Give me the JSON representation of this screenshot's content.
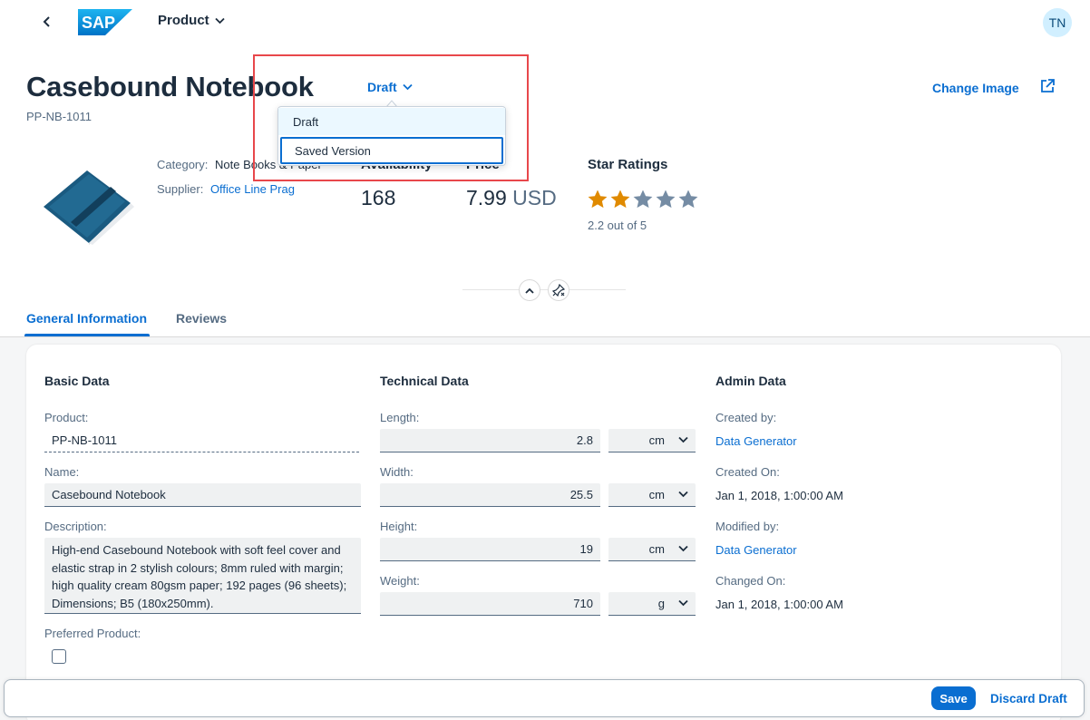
{
  "shell": {
    "app_title": "Product",
    "avatar_initials": "TN",
    "logo_text": "SAP"
  },
  "header": {
    "title": "Casebound Notebook",
    "subtitle": "PP-NB-1011",
    "draft_label": "Draft",
    "change_image": "Change Image",
    "category_label": "Category:",
    "category_value": "Note Books & Paper",
    "supplier_label": "Supplier:",
    "supplier_value": "Office Line Prag",
    "availability_label": "Availability",
    "availability_value": "168",
    "price_label": "Price",
    "price_value": "7.99",
    "price_unit": "USD",
    "ratings_label": "Star Ratings",
    "rating_value": 2.2,
    "rating_max": 5,
    "rating_text": "2.2 out of 5"
  },
  "version_menu": {
    "items": [
      {
        "label": "Draft",
        "state": "selected"
      },
      {
        "label": "Saved Version",
        "state": "focused"
      }
    ]
  },
  "tabs": [
    {
      "label": "General Information",
      "active": true
    },
    {
      "label": "Reviews",
      "active": false
    }
  ],
  "basic": {
    "title": "Basic Data",
    "product_label": "Product:",
    "product_value": "PP-NB-1011",
    "name_label": "Name:",
    "name_value": "Casebound Notebook",
    "description_label": "Description:",
    "description_value": "High-end Casebound Notebook with soft feel cover and elastic strap in 2 stylish colours; 8mm ruled with margin; high quality cream 80gsm paper; 192 pages (96 sheets); Dimensions; B5 (180x250mm).",
    "preferred_label": "Preferred Product:",
    "preferred_checked": false
  },
  "technical": {
    "title": "Technical Data",
    "fields": [
      {
        "label": "Length:",
        "value": "2.8",
        "unit": "cm"
      },
      {
        "label": "Width:",
        "value": "25.5",
        "unit": "cm"
      },
      {
        "label": "Height:",
        "value": "19",
        "unit": "cm"
      },
      {
        "label": "Weight:",
        "value": "710",
        "unit": "g"
      }
    ]
  },
  "admin": {
    "title": "Admin Data",
    "created_by_label": "Created by:",
    "created_by_value": "Data Generator",
    "created_on_label": "Created On:",
    "created_on_value": "Jan 1, 2018, 1:00:00 AM",
    "modified_by_label": "Modified by:",
    "modified_by_value": "Data Generator",
    "changed_on_label": "Changed On:",
    "changed_on_value": "Jan 1, 2018, 1:00:00 AM"
  },
  "footer": {
    "save": "Save",
    "discard": "Discard Draft"
  },
  "colors": {
    "accent": "#0a6ed1",
    "star_filled": "#e08a00",
    "star_empty": "#758ca4",
    "highlight": "#e8474b"
  }
}
